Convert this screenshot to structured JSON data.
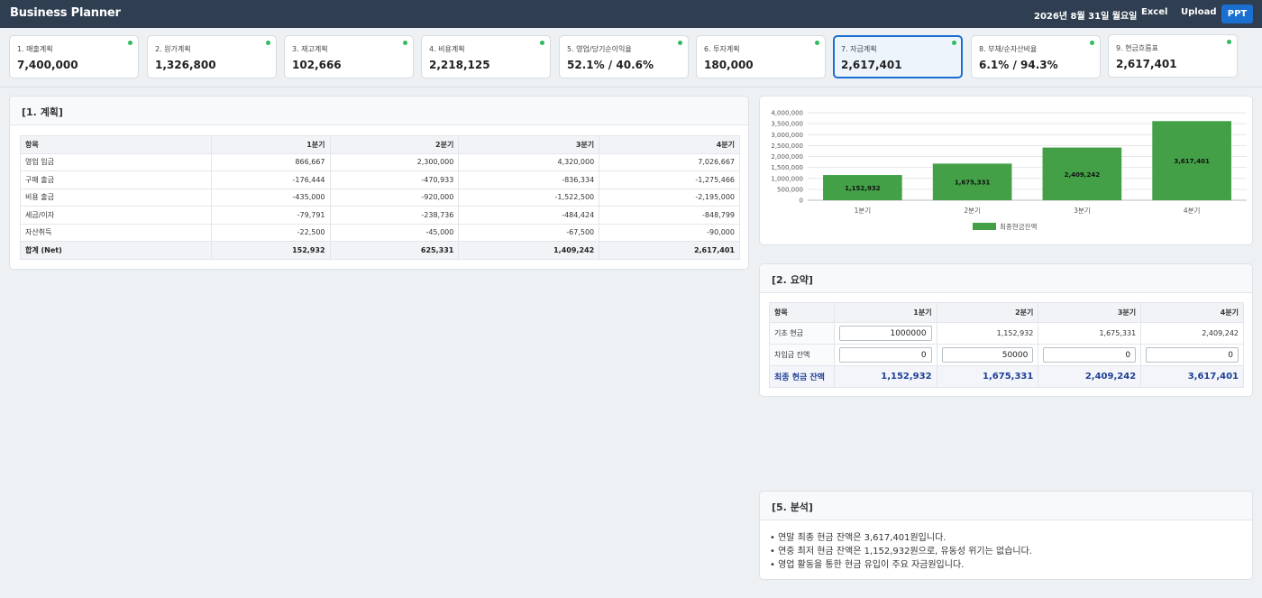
{
  "header": {
    "brand": "Business Planner",
    "date": "2026년 8월 31일 월요일",
    "excel_label": "Excel",
    "upload_label": "Upload",
    "ppt_label": "PPT"
  },
  "kpis": [
    {
      "label": "1. 매출계획",
      "value": "7,400,000",
      "dot": true
    },
    {
      "label": "2. 원가계획",
      "value": "1,326,800",
      "dot": true
    },
    {
      "label": "3. 재고계획",
      "value": "102,666",
      "dot": true
    },
    {
      "label": "4. 비용계획",
      "value": "2,218,125",
      "dot": true
    },
    {
      "label": "5. 영업/당기순이익율",
      "value": "52.1% / 40.6%",
      "dot": true
    },
    {
      "label": "6. 투자계획",
      "value": "180,000",
      "dot": true
    },
    {
      "label": "7. 자금계획",
      "value": "2,617,401",
      "dot": true,
      "active": true
    },
    {
      "label": "8. 부채/순자산비율",
      "value": "6.1% / 94.3%",
      "dot": true
    },
    {
      "label": "9. 현금흐름표",
      "value": "2,617,401",
      "dot": true
    }
  ],
  "plan": {
    "title": "[1. 계획]",
    "headers": [
      "항목",
      "1분기",
      "2분기",
      "3분기",
      "4분기"
    ],
    "rows": [
      [
        "영업 입금",
        "866,667",
        "2,300,000",
        "4,320,000",
        "7,026,667"
      ],
      [
        "구매 출금",
        "-176,444",
        "-470,933",
        "-836,334",
        "-1,275,466"
      ],
      [
        "비용 출금",
        "-435,000",
        "-920,000",
        "-1,522,500",
        "-2,195,000"
      ],
      [
        "세금/이자",
        "-79,791",
        "-238,736",
        "-484,424",
        "-848,799"
      ],
      [
        "자산취득",
        "-22,500",
        "-45,000",
        "-67,500",
        "-90,000"
      ]
    ],
    "total": [
      "합계 (Net)",
      "152,932",
      "625,331",
      "1,409,242",
      "2,617,401"
    ]
  },
  "chart_data": {
    "type": "bar",
    "categories": [
      "1분기",
      "2분기",
      "3분기",
      "4분기"
    ],
    "series": [
      {
        "name": "최종현금잔액",
        "values": [
          1152932,
          1675331,
          2409242,
          3617401
        ],
        "color": "#43a047"
      }
    ],
    "data_labels": [
      "1,152,932",
      "1,675,331",
      "2,409,242",
      "3,617,401"
    ],
    "ylim": [
      0,
      4000000
    ],
    "yticks": [
      "4,000,000",
      "3,500,000",
      "3,000,000",
      "2,500,000",
      "2,000,000",
      "1,500,000",
      "1,000,000",
      "500,000",
      "0"
    ],
    "grid": true,
    "legend_position": "bottom"
  },
  "summary": {
    "title": "[2. 요약]",
    "headers": [
      "항목",
      "1분기",
      "2분기",
      "3분기",
      "4분기"
    ],
    "opening_label": "기초 현금",
    "opening_input": "1000000",
    "opening": [
      "1,152,932",
      "1,675,331",
      "2,409,242"
    ],
    "loan_label": "차입금 잔액",
    "loan_inputs": [
      "0",
      "50000",
      "0",
      "0"
    ],
    "final_label": "최종 현금 잔액",
    "final": [
      "1,152,932",
      "1,675,331",
      "2,409,242",
      "3,617,401"
    ]
  },
  "analysis": {
    "title": "[5. 분석]",
    "bullets": [
      "• 연말 최종 현금 잔액은 3,617,401원입니다.",
      "• 연중 최저 현금 잔액은 1,152,932원으로, 유동성 위기는 없습니다.",
      "• 영업 활동을 통한 현금 유입이 주요 자금원입니다."
    ]
  }
}
